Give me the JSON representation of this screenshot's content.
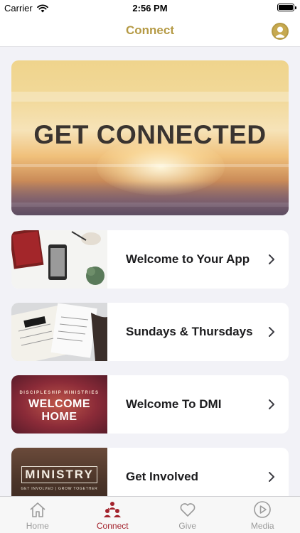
{
  "status_bar": {
    "carrier": "Carrier",
    "time": "2:56 PM"
  },
  "nav": {
    "title": "Connect",
    "title_color": "#b59a45"
  },
  "hero": {
    "title": "GET CONNECTED"
  },
  "cards": [
    {
      "label": "Welcome to Your App",
      "thumb_icon": "desk-phone-photo"
    },
    {
      "label": "Sundays & Thursdays",
      "thumb_icon": "notebook-photo"
    },
    {
      "label": "Welcome To DMI",
      "thumb_icon": "welcome-home-graphic",
      "thumb_top_text": "DISCIPLESHIP MINISTRIES",
      "thumb_main_text": "WELCOME HOME"
    },
    {
      "label": "Get Involved",
      "thumb_icon": "ministry-graphic",
      "thumb_main_text": "MINISTRY",
      "thumb_sub_text": "GET INVOLVED | GROW TOGETHER"
    }
  ],
  "tabs": [
    {
      "label": "Home",
      "icon": "home-icon",
      "active": false
    },
    {
      "label": "Connect",
      "icon": "people-icon",
      "active": true
    },
    {
      "label": "Give",
      "icon": "heart-icon",
      "active": false
    },
    {
      "label": "Media",
      "icon": "play-icon",
      "active": false
    }
  ],
  "colors": {
    "accent": "#b59a45",
    "active_tab": "#a3222c",
    "inactive_tab": "#9b9b9b"
  }
}
